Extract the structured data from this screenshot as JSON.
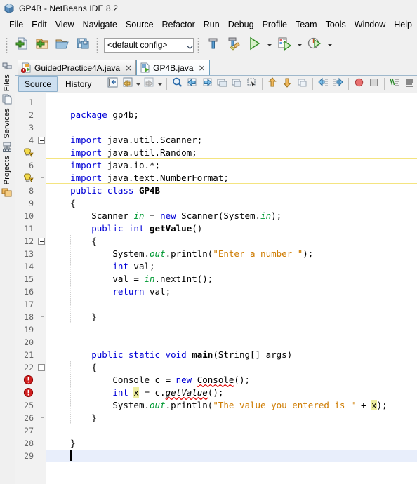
{
  "window": {
    "title": "GP4B - NetBeans IDE 8.2",
    "icon": "netbeans-cube-icon"
  },
  "menubar": {
    "items": [
      {
        "label": "File"
      },
      {
        "label": "Edit"
      },
      {
        "label": "View"
      },
      {
        "label": "Navigate"
      },
      {
        "label": "Source"
      },
      {
        "label": "Refactor"
      },
      {
        "label": "Run"
      },
      {
        "label": "Debug"
      },
      {
        "label": "Profile"
      },
      {
        "label": "Team"
      },
      {
        "label": "Tools"
      },
      {
        "label": "Window"
      },
      {
        "label": "Help"
      }
    ]
  },
  "toolbar": {
    "config_value": "<default config>",
    "buttons": [
      {
        "name": "new-file-button",
        "icon": "new-file-icon"
      },
      {
        "name": "new-project-button",
        "icon": "new-project-icon"
      },
      {
        "name": "open-project-button",
        "icon": "open-project-icon"
      },
      {
        "name": "save-all-button",
        "icon": "save-all-icon"
      },
      {
        "name": "build-project-button",
        "icon": "hammer-icon"
      },
      {
        "name": "clean-and-build-button",
        "icon": "hammer-broom-icon"
      },
      {
        "name": "run-project-button",
        "icon": "green-play-icon"
      },
      {
        "name": "debug-project-button",
        "icon": "debug-icon"
      },
      {
        "name": "profile-project-button",
        "icon": "profile-clock-icon"
      }
    ]
  },
  "left_strip": {
    "tabs": [
      {
        "label": "Files",
        "icon": "files-icon"
      },
      {
        "label": "Services",
        "icon": "services-icon"
      },
      {
        "label": "Projects",
        "icon": "projects-icon"
      }
    ]
  },
  "editor_tabs": [
    {
      "label": "GuidedPractice4A.java",
      "icon": "java-file-error-icon",
      "active": false,
      "close": "×"
    },
    {
      "label": "GP4B.java",
      "icon": "java-file-icon",
      "active": true,
      "close": "×"
    }
  ],
  "editor_toolbar": {
    "view_tabs": [
      {
        "label": "Source",
        "selected": true
      },
      {
        "label": "History",
        "selected": false
      }
    ],
    "buttons": [
      {
        "name": "last-edit-button",
        "icon": "last-edit-icon"
      },
      {
        "name": "back-button",
        "icon": "back-arrow-icon"
      },
      {
        "name": "forward-button",
        "icon": "forward-arrow-icon"
      },
      {
        "name": "find-selection-button",
        "icon": "magnifier-icon"
      },
      {
        "name": "find-previous-button",
        "icon": "find-previous-icon"
      },
      {
        "name": "find-next-button",
        "icon": "find-next-icon"
      },
      {
        "name": "toggle-highlight-button",
        "icon": "highlight-icon"
      },
      {
        "name": "previous-bookmark-button",
        "icon": "prev-bookmark-icon"
      },
      {
        "name": "toggle-rectangular-selection-button",
        "icon": "rect-select-icon"
      },
      {
        "name": "shift-line-left-button",
        "icon": "shift-left-icon"
      },
      {
        "name": "shift-line-right-button",
        "icon": "shift-right-icon"
      },
      {
        "name": "start-macro-recording-button",
        "icon": "record-icon"
      },
      {
        "name": "stop-macro-recording-button",
        "icon": "stop-icon"
      },
      {
        "name": "comment-button",
        "icon": "comment-icon"
      },
      {
        "name": "uncomment-button",
        "icon": "uncomment-icon"
      }
    ]
  },
  "code": {
    "file": "GP4B.java",
    "current_line": 29,
    "lines": [
      {
        "n": "1",
        "glyph": null,
        "text": ""
      },
      {
        "n": "2",
        "glyph": null,
        "text": "package gp4b;"
      },
      {
        "n": "3",
        "glyph": null,
        "text": ""
      },
      {
        "n": "4",
        "glyph": null,
        "text": "import java.util.Scanner;"
      },
      {
        "n": "5",
        "glyph": "warning",
        "text": "import java.util.Random;"
      },
      {
        "n": "6",
        "glyph": null,
        "text": "import java.io.*;"
      },
      {
        "n": "7",
        "glyph": "warning",
        "text": "import java.text.NumberFormat;"
      },
      {
        "n": "8",
        "glyph": null,
        "text": "public class GP4B"
      },
      {
        "n": "9",
        "glyph": null,
        "text": "{"
      },
      {
        "n": "10",
        "glyph": null,
        "text": "    Scanner in = new Scanner(System.in);"
      },
      {
        "n": "11",
        "glyph": null,
        "text": "    public int getValue()"
      },
      {
        "n": "12",
        "glyph": null,
        "text": "    {"
      },
      {
        "n": "13",
        "glyph": null,
        "text": "        System.out.println(\"Enter a number \");"
      },
      {
        "n": "14",
        "glyph": null,
        "text": "        int val;"
      },
      {
        "n": "15",
        "glyph": null,
        "text": "        val = in.nextInt();"
      },
      {
        "n": "16",
        "glyph": null,
        "text": "        return val;"
      },
      {
        "n": "17",
        "glyph": null,
        "text": ""
      },
      {
        "n": "18",
        "glyph": null,
        "text": "    }"
      },
      {
        "n": "19",
        "glyph": null,
        "text": ""
      },
      {
        "n": "20",
        "glyph": null,
        "text": ""
      },
      {
        "n": "21",
        "glyph": null,
        "text": "    public static void main(String[] args)"
      },
      {
        "n": "22",
        "glyph": null,
        "text": "    {"
      },
      {
        "n": "23",
        "glyph": "error",
        "text": "        Console c = new Console();"
      },
      {
        "n": "24",
        "glyph": "error",
        "text": "        int x = c.getValue();"
      },
      {
        "n": "25",
        "glyph": null,
        "text": "        System.out.println(\"The value you entered is \" + x);"
      },
      {
        "n": "26",
        "glyph": null,
        "text": "    }"
      },
      {
        "n": "27",
        "glyph": null,
        "text": ""
      },
      {
        "n": "28",
        "glyph": null,
        "text": "}"
      },
      {
        "n": "29",
        "glyph": null,
        "text": ""
      }
    ]
  },
  "colors": {
    "keyword": "#0000d6",
    "string": "#ce7b00",
    "field": "#009933",
    "error_underline": "#e00000",
    "warning_underline": "#e8c800",
    "current_line_bg": "#e8eefb",
    "occurrence_highlight": "#eeee9e",
    "chrome_bg": "#f0f0f0",
    "editor_bg": "#ffffff"
  }
}
